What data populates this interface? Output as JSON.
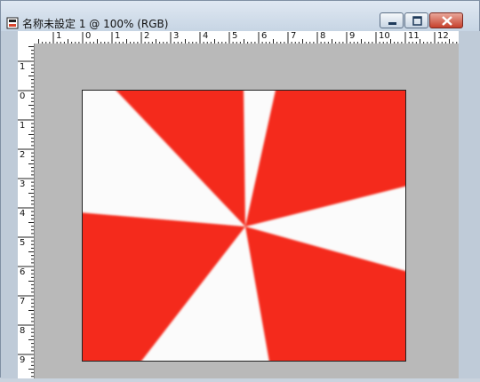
{
  "window": {
    "title": "名称未設定 1 @ 100% (RGB)",
    "icon": "document-image-icon",
    "buttons": {
      "minimize": "minimize-icon",
      "maximize": "maximize-icon",
      "close": "close-icon"
    }
  },
  "rulers": {
    "top_labels": [
      "1",
      "0",
      "1",
      "2",
      "3",
      "4",
      "5",
      "6",
      "7",
      "8",
      "9",
      "10",
      "11",
      "12"
    ],
    "left_labels": [
      "1",
      "0",
      "1",
      "2",
      "3",
      "4",
      "5",
      "6",
      "7",
      "8",
      "9"
    ]
  },
  "colors": {
    "red": "#f42a1d",
    "white": "#fbfbfb",
    "pasteboard": "#b9b9b9"
  }
}
